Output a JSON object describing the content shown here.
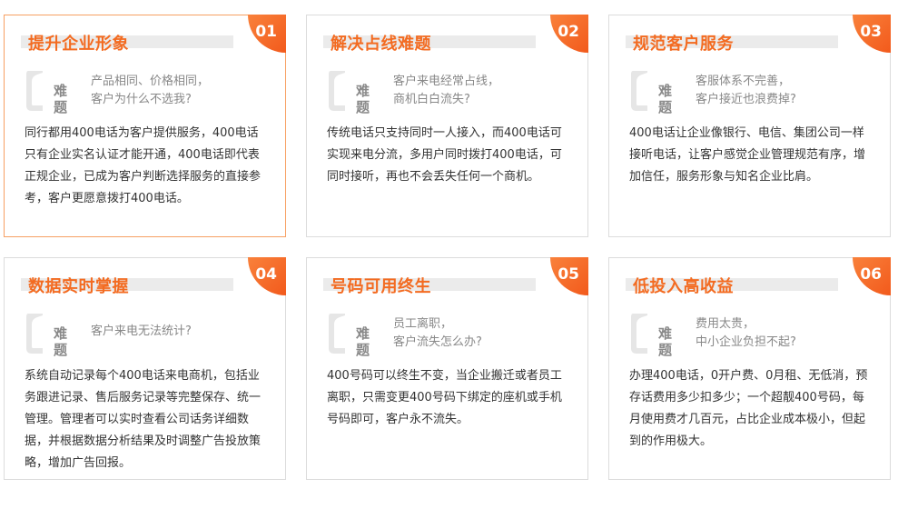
{
  "cards": [
    {
      "num": "01",
      "title": "提升企业形象",
      "tag": [
        "难",
        "题"
      ],
      "problem": [
        "产品相同、价格相同，",
        "客户为什么不选我?"
      ],
      "desc": "同行都用400电话为客户提供服务，400电话只有企业实名认证才能开通，400电话即代表正规企业，已成为客户判断选择服务的直接参考，客户更愿意拨打400电话。"
    },
    {
      "num": "02",
      "title": "解决占线难题",
      "tag": [
        "难",
        "题"
      ],
      "problem": [
        "客户来电经常占线，",
        "商机白白流失?"
      ],
      "desc": "传统电话只支持同时一人接入，而400电话可实现来电分流，多用户同时拨打400电话，可同时接听，再也不会丢失任何一个商机。"
    },
    {
      "num": "03",
      "title": "规范客户服务",
      "tag": [
        "难",
        "题"
      ],
      "problem": [
        "客服体系不完善，",
        "客户接近也浪费掉?"
      ],
      "desc": "400电话让企业像银行、电信、集团公司一样接听电话，让客户感觉企业管理规范有序，增加信任，服务形象与知名企业比肩。"
    },
    {
      "num": "04",
      "title": "数据实时掌握",
      "tag": [
        "难",
        "题"
      ],
      "problem": [
        "客户来电无法统计?"
      ],
      "desc": "系统自动记录每个400电话来电商机，包括业务跟进记录、售后服务记录等完整保存、统一管理。管理者可以实时查看公司话务详细数据，并根据数据分析结果及时调整广告投放策略，增加广告回报。"
    },
    {
      "num": "05",
      "title": "号码可用终生",
      "tag": [
        "难",
        "题"
      ],
      "problem": [
        "员工离职，",
        "客户流失怎么办?"
      ],
      "desc": "400号码可以终生不变，当企业搬迁或者员工离职，只需变更400号码下绑定的座机或手机号码即可，客户永不流失。"
    },
    {
      "num": "06",
      "title": "低投入高收益",
      "tag": [
        "难",
        "题"
      ],
      "problem": [
        "费用太贵，",
        "中小企业负担不起?"
      ],
      "desc": "办理400电话，0开户费、0月租、无低消，预存话费用多少扣多少；一个超靓400号码，每月使用费才几百元，占比企业成本极小，但起到的作用极大。"
    }
  ],
  "colors": {
    "accent": "#f36b21",
    "border": "#dcdcdc",
    "active_border": "#f7a063"
  },
  "icons": {
    "quote": "quote-mark-icon"
  }
}
